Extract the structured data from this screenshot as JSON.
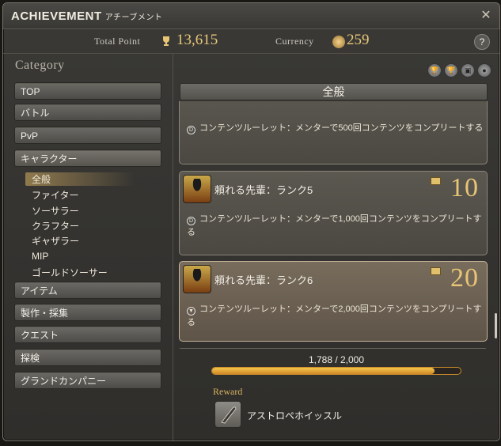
{
  "window": {
    "title": "ACHIEVEMENT",
    "title_ja": "アチーブメント",
    "close_icon": "gear-close-icon"
  },
  "stats": {
    "total_point_label": "Total Point",
    "total_point_value": "13,615",
    "currency_label": "Currency",
    "currency_value": "259"
  },
  "sidebar": {
    "category_label": "Category",
    "items": [
      "TOP",
      "バトル",
      "PvP",
      "キャラクター",
      "アイテム",
      "製作・採集",
      "クエスト",
      "探検",
      "グランドカンパニー"
    ],
    "subitems": [
      "全般",
      "ファイター",
      "ソーサラー",
      "クラフター",
      "ギャザラー",
      "MIP",
      "ゴールドソーサー"
    ]
  },
  "main": {
    "header": "全般",
    "filter_icons": [
      "trophy-filter-icon",
      "trophy-filter-icon",
      "chest-filter-icon",
      "person-filter-icon"
    ],
    "cards": [
      {
        "name": "",
        "points": "",
        "desc": "コンテンツルーレット：メンターで500回コンテンツをコンプリートする"
      },
      {
        "name": "頼れる先輩：ランク5",
        "points": "10",
        "desc": "コンテンツルーレット：メンターで1,000回コンテンツをコンプリートする"
      },
      {
        "name": "頼れる先輩：ランク6",
        "points": "20",
        "desc": "コンテンツルーレット：メンターで2,000回コンテンツをコンプリートする"
      }
    ],
    "progress": {
      "text": "1,788 / 2,000",
      "fraction": 0.894
    },
    "reward": {
      "label": "Reward",
      "name": "アストロペホイッスル"
    }
  },
  "colors": {
    "accent_gold": "#e8c476",
    "progress_fill": "#f4c64a"
  }
}
